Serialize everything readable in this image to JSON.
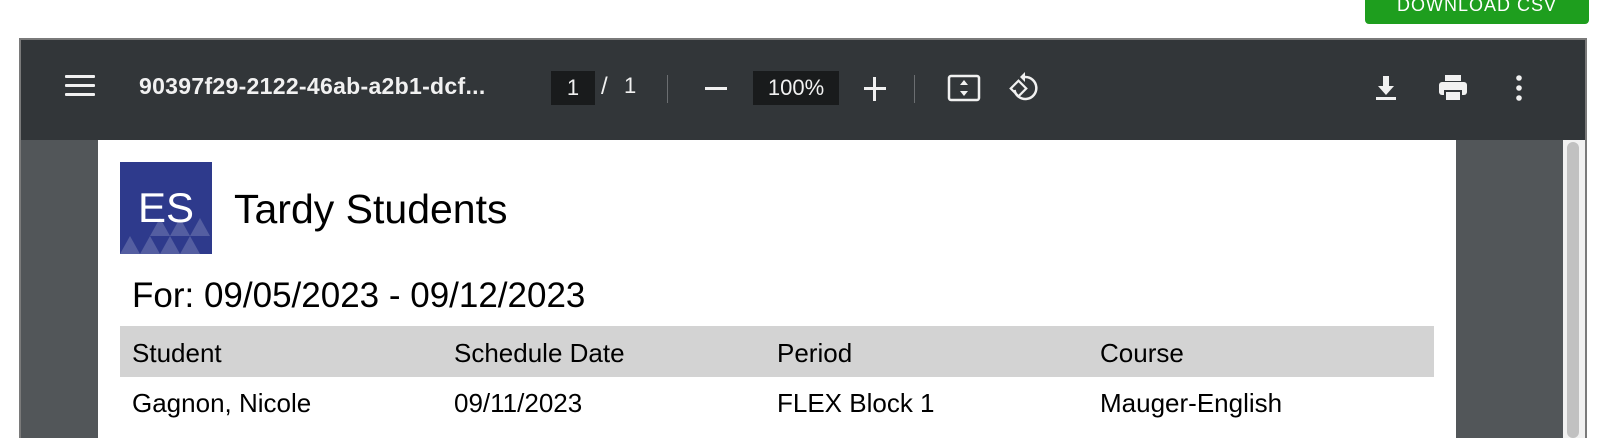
{
  "page": {
    "download_button_label": "DOWNLOAD CSV"
  },
  "viewer": {
    "file_name": "90397f29-2122-46ab-a2b1-dcf...",
    "current_page": "1",
    "page_separator": "/",
    "total_pages": "1",
    "zoom": "100%",
    "icons": [
      "menu-icon",
      "zoom-out-icon",
      "zoom-in-icon",
      "fit-page-icon",
      "rotate-icon",
      "download-icon",
      "print-icon",
      "more-options-icon"
    ]
  },
  "document": {
    "logo_text": "ES",
    "title": "Tardy Students",
    "date_range": "For: 09/05/2023 - 09/12/2023",
    "columns": [
      "Student",
      "Schedule Date",
      "Period",
      "Course"
    ],
    "rows": [
      [
        "Gagnon, Nicole",
        "09/11/2023",
        "FLEX Block 1",
        "Mauger-English"
      ]
    ]
  },
  "colors": {
    "download_button": "#1e9e1e",
    "toolbar": "#323639",
    "viewer_background": "#525659",
    "logo_background": "#2e3a8c",
    "table_header": "#d3d3d3"
  }
}
